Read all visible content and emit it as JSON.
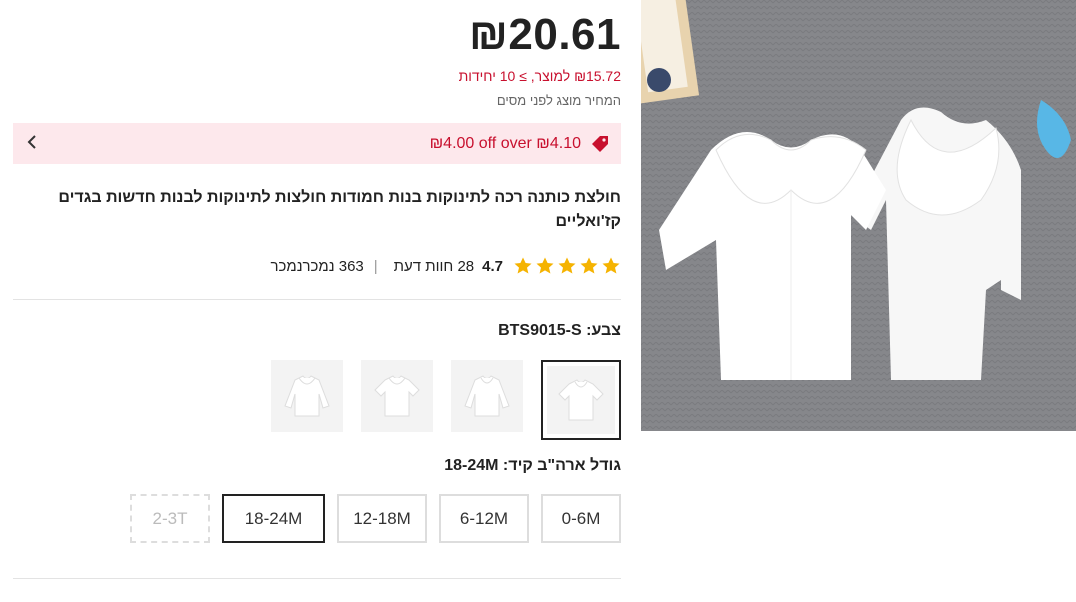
{
  "product": {
    "price": "₪20.61",
    "unit_price": "₪15.72 למוצר, ≥ 10 יחידות",
    "tax_note": "המחיר מוצג לפני מסים",
    "promo_text": "₪4.00 off over ₪4.10",
    "title": "חולצת כותנה רכה לתינוקות בנות חמודות חולצות לתינוקות לבנות חדשות בגדים קז'ואליים",
    "rating_score": "4.7",
    "reviews_count": "28",
    "reviews_label": "חוות דעת",
    "sold_count": "363",
    "sold_label": "נמכרנמכר"
  },
  "options": {
    "color_label": "צבע:",
    "color_value": "BTS9015-S",
    "size_label": "גודל ארה\"ב קיד:",
    "size_value": "18-24M",
    "sizes": [
      "0-6M",
      "6-12M",
      "12-18M",
      "18-24M",
      "2-3T"
    ]
  },
  "colors": {
    "accent": "#c8102e",
    "promo_bg": "#fde8ec",
    "star": "#f5b301"
  },
  "icons": {
    "promo": "tag-icon",
    "chevron": "chevron-left-icon",
    "star": "star-icon"
  }
}
